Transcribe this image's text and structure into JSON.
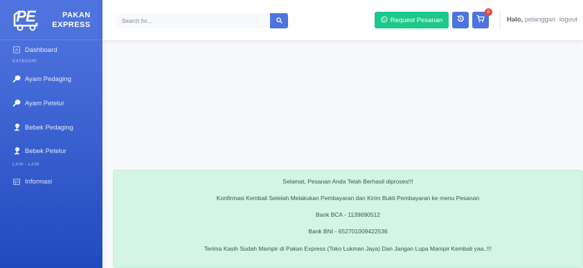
{
  "brand": {
    "logo_text": "PE",
    "name_line1": "PAKAN",
    "name_line2": "EXPRESS"
  },
  "sidebar": {
    "dashboard": "Dashboard",
    "heading_kategori": "KATEGORI",
    "items": [
      "Ayam Pedaging",
      "Ayam Petelur",
      "Bebek Pedaging",
      "Bebek Petelur"
    ],
    "heading_lain": "LAIN - LAIN",
    "informasi": "Informasi"
  },
  "topbar": {
    "search_placeholder": "Search for...",
    "request_label": "Request Pesanan",
    "cart_count": "0",
    "greeting": "Halo,",
    "username": "pelanggan",
    "logout": "logout"
  },
  "alert": {
    "lines": [
      "Selamat, Pesanan Anda Telah Berhasil diproses!!!",
      "Konfirmasi Kembali Setelah Melakukan Pembayaran dan Kirim Bukti Pembayaran ke menu Pesanan",
      "Bank BCA - 1139690512",
      "Bank BNI - 652701009422536",
      "Terima Kasih Sudah Mampir di Pakan Express (Toko Lukman Jaya) Dan Jangan Lupa Mampir Kembali yaa..!!!"
    ]
  },
  "colors": {
    "primary": "#4e73df",
    "success": "#1cc88a",
    "danger": "#e74a3b",
    "alert_bg": "#d4f4e6"
  }
}
